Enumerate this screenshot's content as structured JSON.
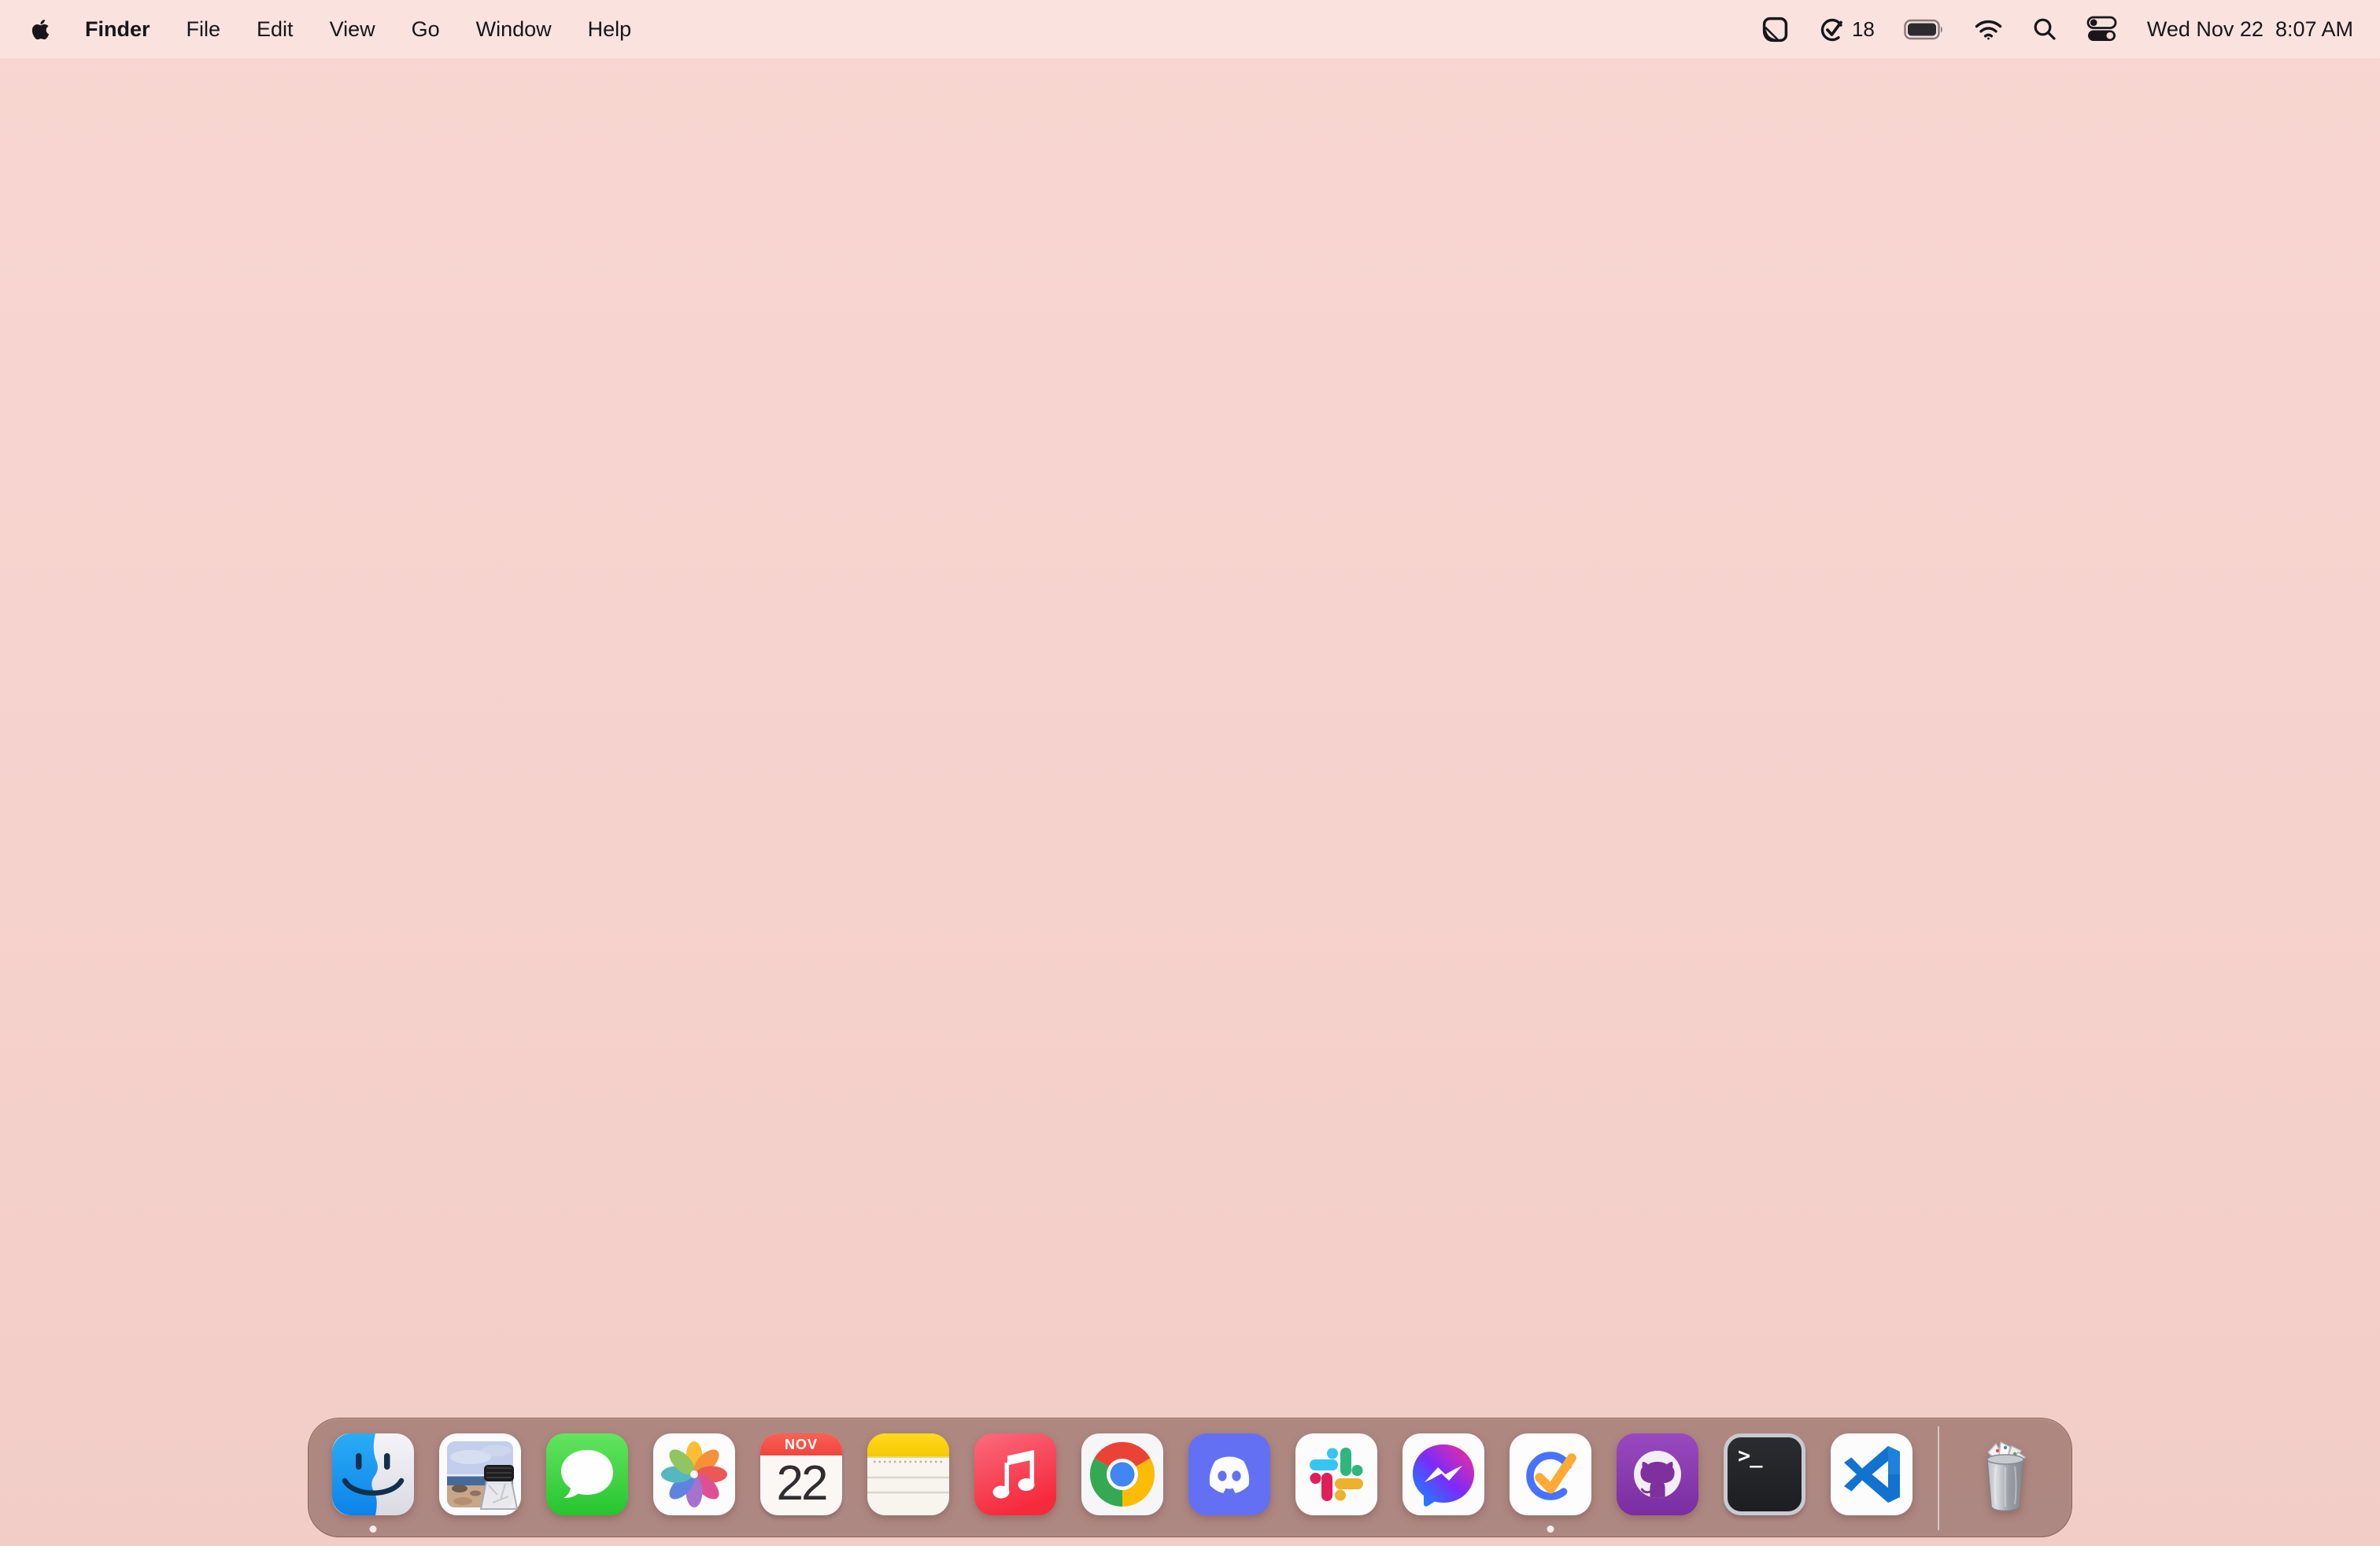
{
  "menubar": {
    "active_app": "Finder",
    "items": [
      "Finder",
      "File",
      "Edit",
      "View",
      "Go",
      "Window",
      "Help"
    ],
    "status": {
      "icons": [
        "folded-note",
        "task-check",
        "battery",
        "wifi",
        "spotlight-search",
        "control-center"
      ],
      "task_count": "18",
      "date": "Wed Nov 22",
      "time": "8:07 AM"
    }
  },
  "dock": {
    "calendar": {
      "month": "NOV",
      "day": "22"
    },
    "terminal_prompt": ">_",
    "trash_state": "full",
    "items": [
      {
        "name": "finder",
        "running": true
      },
      {
        "name": "preview",
        "running": false
      },
      {
        "name": "messages",
        "running": false
      },
      {
        "name": "photos",
        "running": false
      },
      {
        "name": "calendar",
        "running": false
      },
      {
        "name": "notes",
        "running": false
      },
      {
        "name": "music",
        "running": false
      },
      {
        "name": "chrome",
        "running": false
      },
      {
        "name": "discord",
        "running": false
      },
      {
        "name": "slack",
        "running": false
      },
      {
        "name": "messenger",
        "running": false
      },
      {
        "name": "ticktick",
        "running": true
      },
      {
        "name": "github-desktop",
        "running": false
      },
      {
        "name": "terminal",
        "running": false
      },
      {
        "name": "vscode",
        "running": false
      },
      {
        "name": "trash",
        "running": false
      }
    ]
  },
  "colors": {
    "wallpaper": "#f6d2cd",
    "dock_background": "rgba(130,92,86,0.62)",
    "menubar_tint": "rgba(255,255,255,0.30)",
    "ticktick_blue": "#4772fa",
    "check_yellow": "#ffaa33",
    "calendar_red": "#ef463c"
  }
}
